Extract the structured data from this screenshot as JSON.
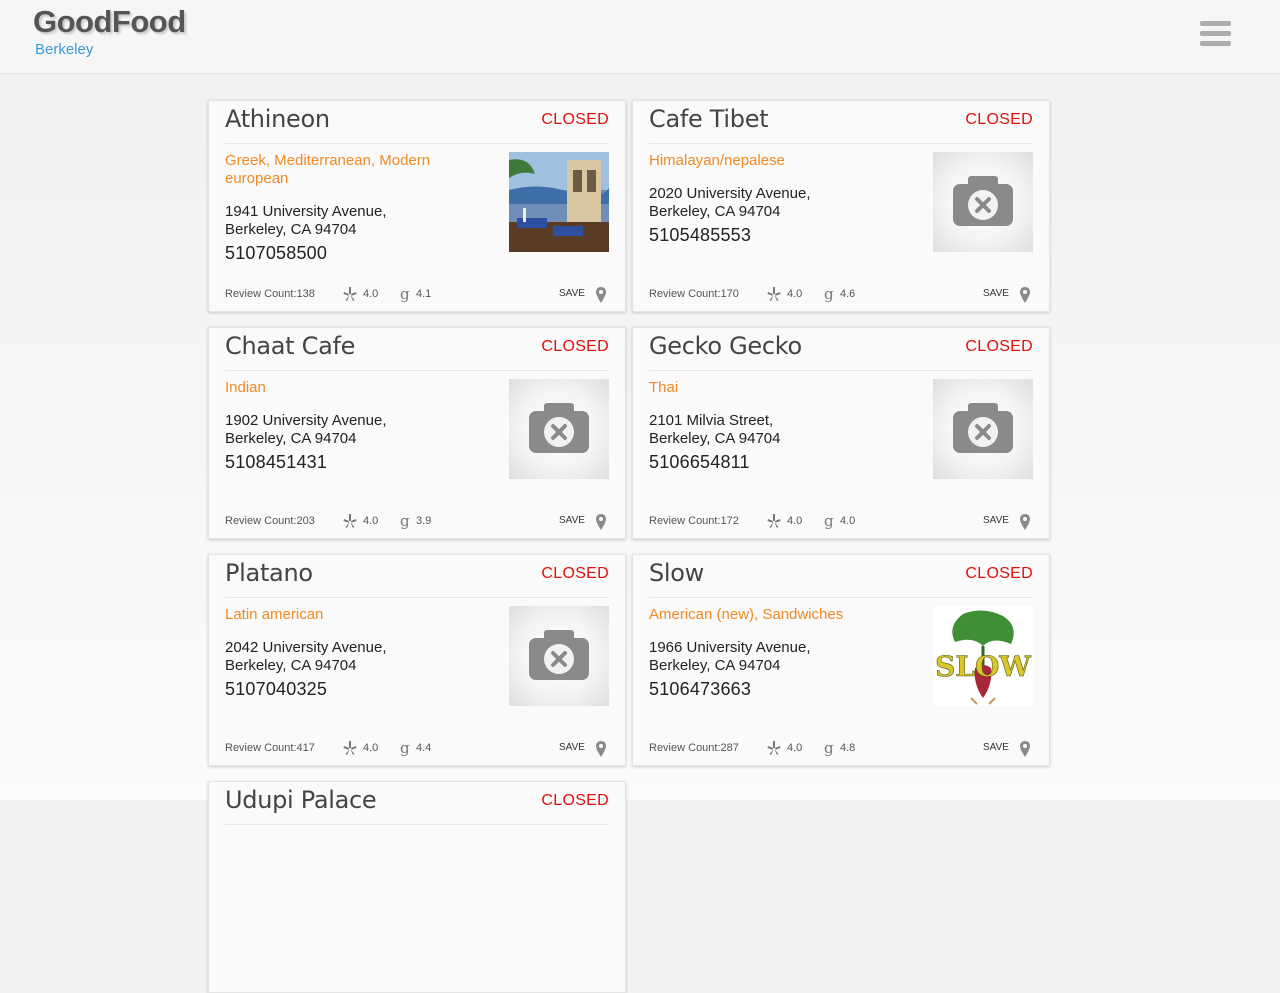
{
  "app": {
    "title": "GoodFood",
    "city": "Berkeley"
  },
  "cards": [
    {
      "name": "Athineon",
      "status": "CLOSED",
      "cuisine": "Greek, Mediterranean, Modern european",
      "address_line1": "1941 University Avenue,",
      "address_line2": "Berkeley, CA 94704",
      "phone": "5107058500",
      "review_count": "Review Count:138",
      "yelp_rating": "4.0",
      "google_rating": "4.1",
      "save_label": "SAVE",
      "image": "photo"
    },
    {
      "name": "Cafe Tibet",
      "status": "CLOSED",
      "cuisine": "Himalayan/nepalese",
      "address_line1": "2020 University Avenue,",
      "address_line2": "Berkeley, CA 94704",
      "phone": "5105485553",
      "review_count": "Review Count:170",
      "yelp_rating": "4.0",
      "google_rating": "4.6",
      "save_label": "SAVE",
      "image": "placeholder"
    },
    {
      "name": "Chaat Cafe",
      "status": "CLOSED",
      "cuisine": "Indian",
      "address_line1": "1902 University Avenue,",
      "address_line2": "Berkeley, CA 94704",
      "phone": "5108451431",
      "review_count": "Review Count:203",
      "yelp_rating": "4.0",
      "google_rating": "3.9",
      "save_label": "SAVE",
      "image": "placeholder"
    },
    {
      "name": "Gecko Gecko",
      "status": "CLOSED",
      "cuisine": "Thai",
      "address_line1": "2101 Milvia Street,",
      "address_line2": "Berkeley, CA 94704",
      "phone": "5106654811",
      "review_count": "Review Count:172",
      "yelp_rating": "4.0",
      "google_rating": "4.0",
      "save_label": "SAVE",
      "image": "placeholder"
    },
    {
      "name": "Platano",
      "status": "CLOSED",
      "cuisine": "Latin american",
      "address_line1": "2042 University Avenue,",
      "address_line2": "Berkeley, CA 94704",
      "phone": "5107040325",
      "review_count": "Review Count:417",
      "yelp_rating": "4.0",
      "google_rating": "4.4",
      "save_label": "SAVE",
      "image": "placeholder"
    },
    {
      "name": "Slow",
      "status": "CLOSED",
      "cuisine": "American (new), Sandwiches",
      "address_line1": "1966 University Avenue,",
      "address_line2": "Berkeley, CA 94704",
      "phone": "5106473663",
      "review_count": "Review Count:287",
      "yelp_rating": "4.0",
      "google_rating": "4.8",
      "save_label": "SAVE",
      "image": "logo",
      "logo_text": "SLOW"
    },
    {
      "name": "Udupi Palace",
      "status": "CLOSED"
    }
  ],
  "colors": {
    "accent": "#3d9bd8",
    "cuisine": "#ef8a24",
    "closed": "#e0100e"
  },
  "icons": {
    "menu": "hamburger-menu-icon",
    "yelp": "yelp-icon",
    "google": "google-icon",
    "pin": "map-pin-icon",
    "no_image": "camera-off-icon"
  }
}
